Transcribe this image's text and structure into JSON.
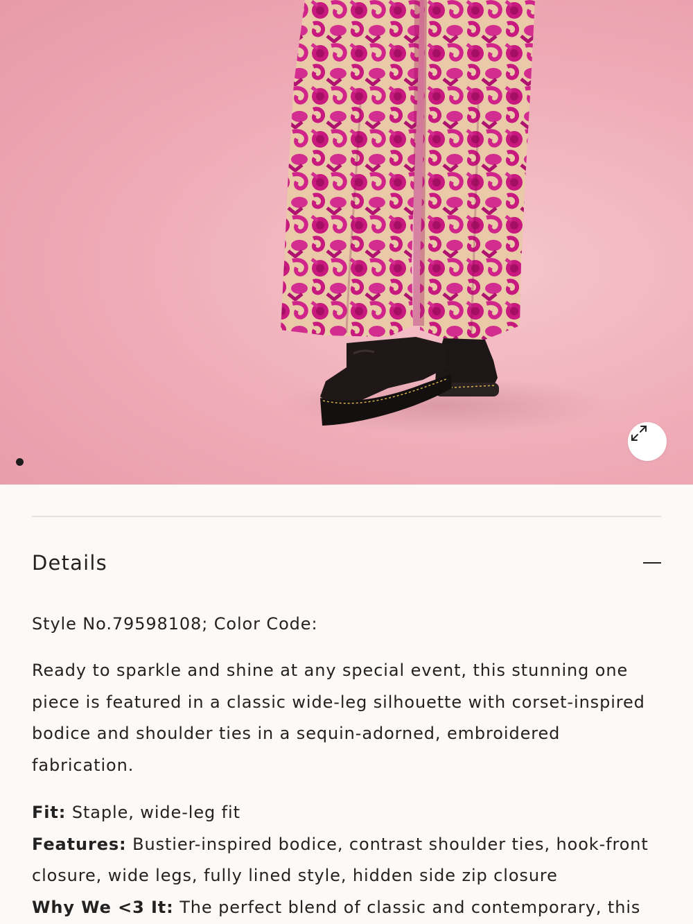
{
  "gallery": {
    "image_alt": "Model wearing pink sequin embroidered wide-leg jumpsuit with black platform boots",
    "active_index": 1,
    "total_images": 1,
    "expand_icon": "expand-arrows-icon"
  },
  "details": {
    "title": "Details",
    "toggle_icon": "minus-icon",
    "style_line": "Style No.79598108; Color Code:",
    "description": "Ready to sparkle and shine at any special event, this stunning one piece is featured in a classic wide-leg silhouette with corset-inspired bodice and shoulder ties in a sequin-adorned, embroidered fabrication.",
    "specs": [
      {
        "label": "Fit:",
        "value": "Staple, wide-leg fit"
      },
      {
        "label": "Features:",
        "value": "Bustier-inspired bodice, contrast shoulder ties, hook-front closure, wide legs, fully lined style, hidden side zip closure"
      },
      {
        "label": "Why We <3 It:",
        "value": "The perfect blend of classic and contemporary, this"
      }
    ]
  },
  "colors": {
    "background": "#fdf9f7",
    "hero_pink": "#eeaab6",
    "sequin_magenta": "#c8197f",
    "text": "#222222"
  }
}
